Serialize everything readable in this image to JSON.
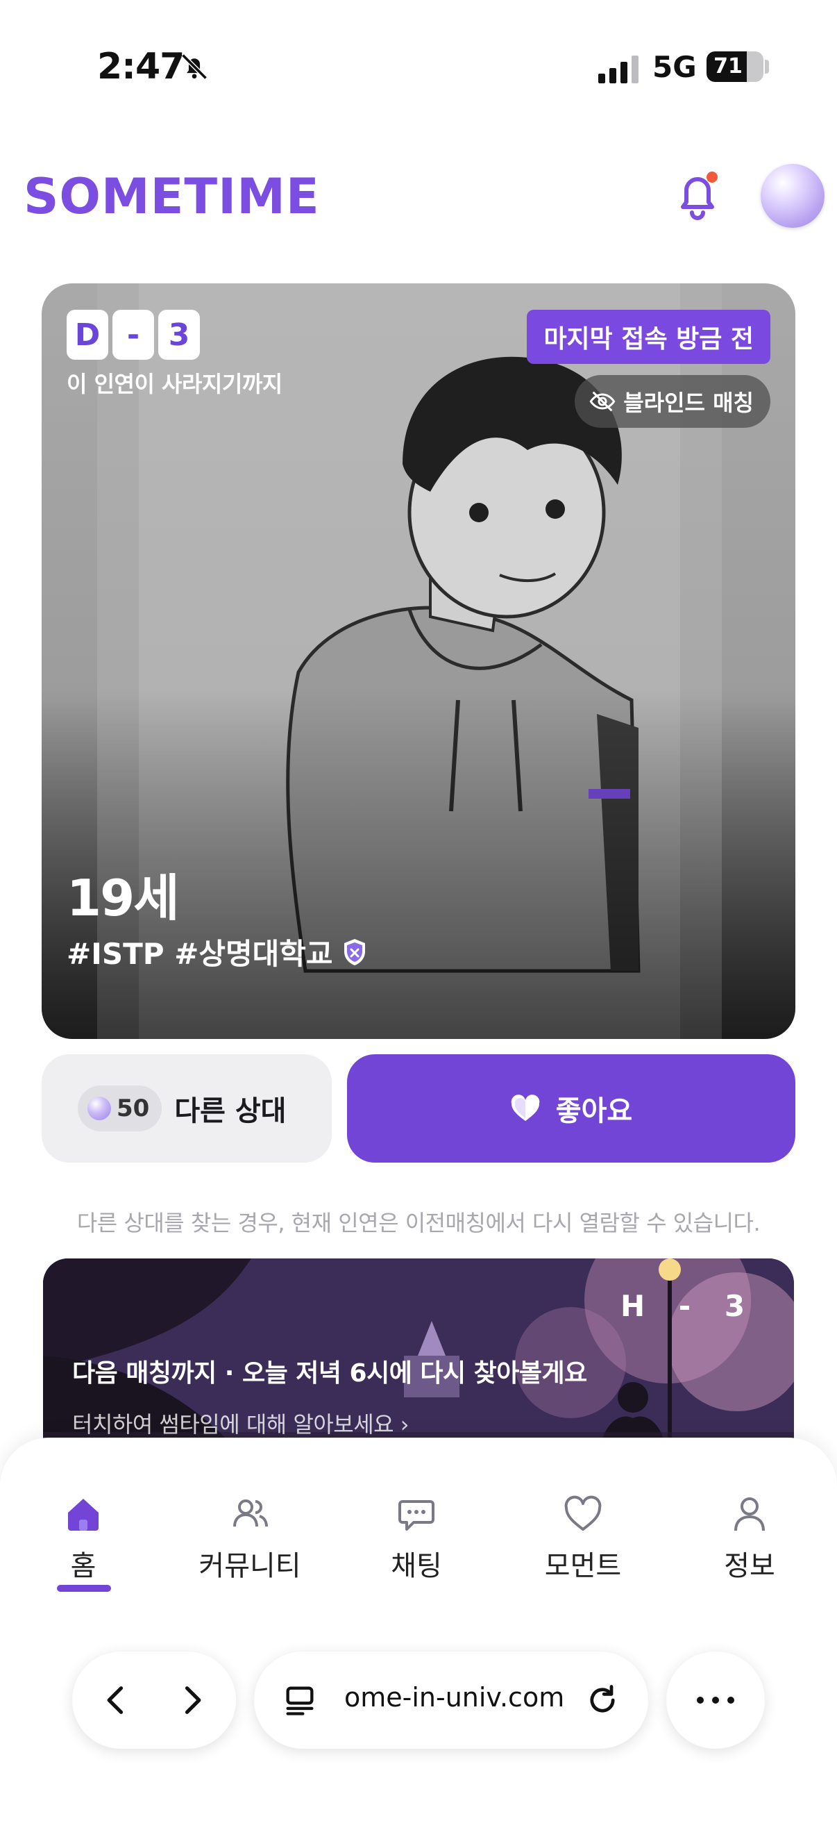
{
  "status_bar": {
    "time": "2:47",
    "network": "5G",
    "battery": "71",
    "battery_level": 0.71
  },
  "header": {
    "logo": "SOMETIME",
    "bell_icon": "bell-icon",
    "avatar_icon": "avatar-orb"
  },
  "card": {
    "dday": [
      "D",
      "-",
      "3"
    ],
    "dday_caption": "이 인연이 사라지기까지",
    "last_access": "마지막 접속 방금 전",
    "blind_match": "블라인드 매칭",
    "age": "19세",
    "tags": "#ISTP #상명대학교"
  },
  "actions": {
    "gem_count": "50",
    "other_label": "다른 상대",
    "like_label": "좋아요"
  },
  "notice": "다른 상대를 찾는 경우, 현재 인연은 이전매칭에서 다시 열람할 수 있습니다.",
  "banner": {
    "timer": "H - 3",
    "title": "다음 매칭까지 · 오늘 저녁 6시에 다시 찾아볼게요",
    "subtitle": "터치하여 썸타임에 대해 알아보세요 ›"
  },
  "nav": {
    "items": [
      {
        "label": "홈",
        "icon": "home-icon",
        "active": true
      },
      {
        "label": "커뮤니티",
        "icon": "users-icon",
        "active": false
      },
      {
        "label": "채팅",
        "icon": "chat-icon",
        "active": false
      },
      {
        "label": "모먼트",
        "icon": "heart-icon",
        "active": false
      },
      {
        "label": "정보",
        "icon": "person-icon",
        "active": false
      }
    ]
  },
  "browser": {
    "url": "ome-in-univ.com"
  },
  "colors": {
    "accent": "#7245d6",
    "logo": "#7b4de0",
    "notification_dot": "#f05a3a"
  }
}
